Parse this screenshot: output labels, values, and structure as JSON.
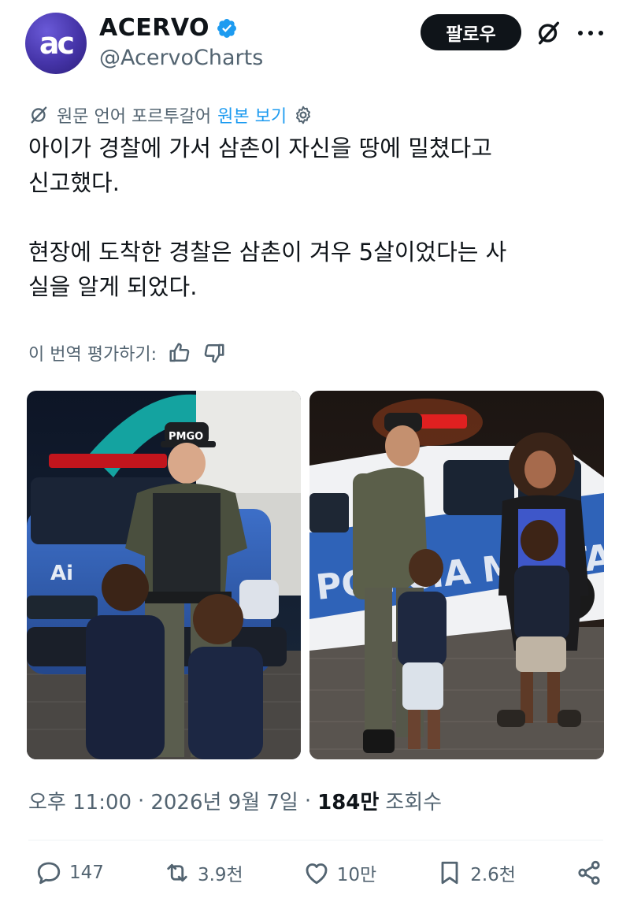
{
  "author": {
    "display_name": "ACERVO",
    "handle": "@AcervoCharts",
    "avatar_text": "ac",
    "verified": true
  },
  "header": {
    "follow_label": "팔로우"
  },
  "translation": {
    "notice": "원문 언어 포르투갈어",
    "show_original": "원본 보기"
  },
  "tweet": {
    "paragraph_1_line_1": "아이가 경찰에 가서 삼촌이 자신을 땅에 밀쳤다고",
    "paragraph_1_line_2": "신고했다.",
    "paragraph_2_line_1": "현장에 도착한 경찰은 삼촌이 겨우 5살이었다는 사",
    "paragraph_2_line_2": "실을 알게 되었다."
  },
  "rate_translation": {
    "label": "이 번역 평가하기:"
  },
  "photos": {
    "left": {
      "cap_text": "PMGO",
      "car_text": "Ai"
    },
    "right": {
      "car_text": "POLÍCIA MILITAR"
    }
  },
  "meta": {
    "time": "오후 11:00",
    "date": "2026년 9월 7일",
    "views_count": "184만",
    "views_label": "조회수",
    "separator": "·"
  },
  "actions": {
    "replies": "147",
    "reposts": "3.9천",
    "likes": "10만",
    "bookmarks": "2.6천"
  },
  "colors": {
    "text_primary": "#0f1419",
    "text_secondary": "#536471",
    "accent": "#1d9bf0",
    "avatar": "#4534a8"
  }
}
